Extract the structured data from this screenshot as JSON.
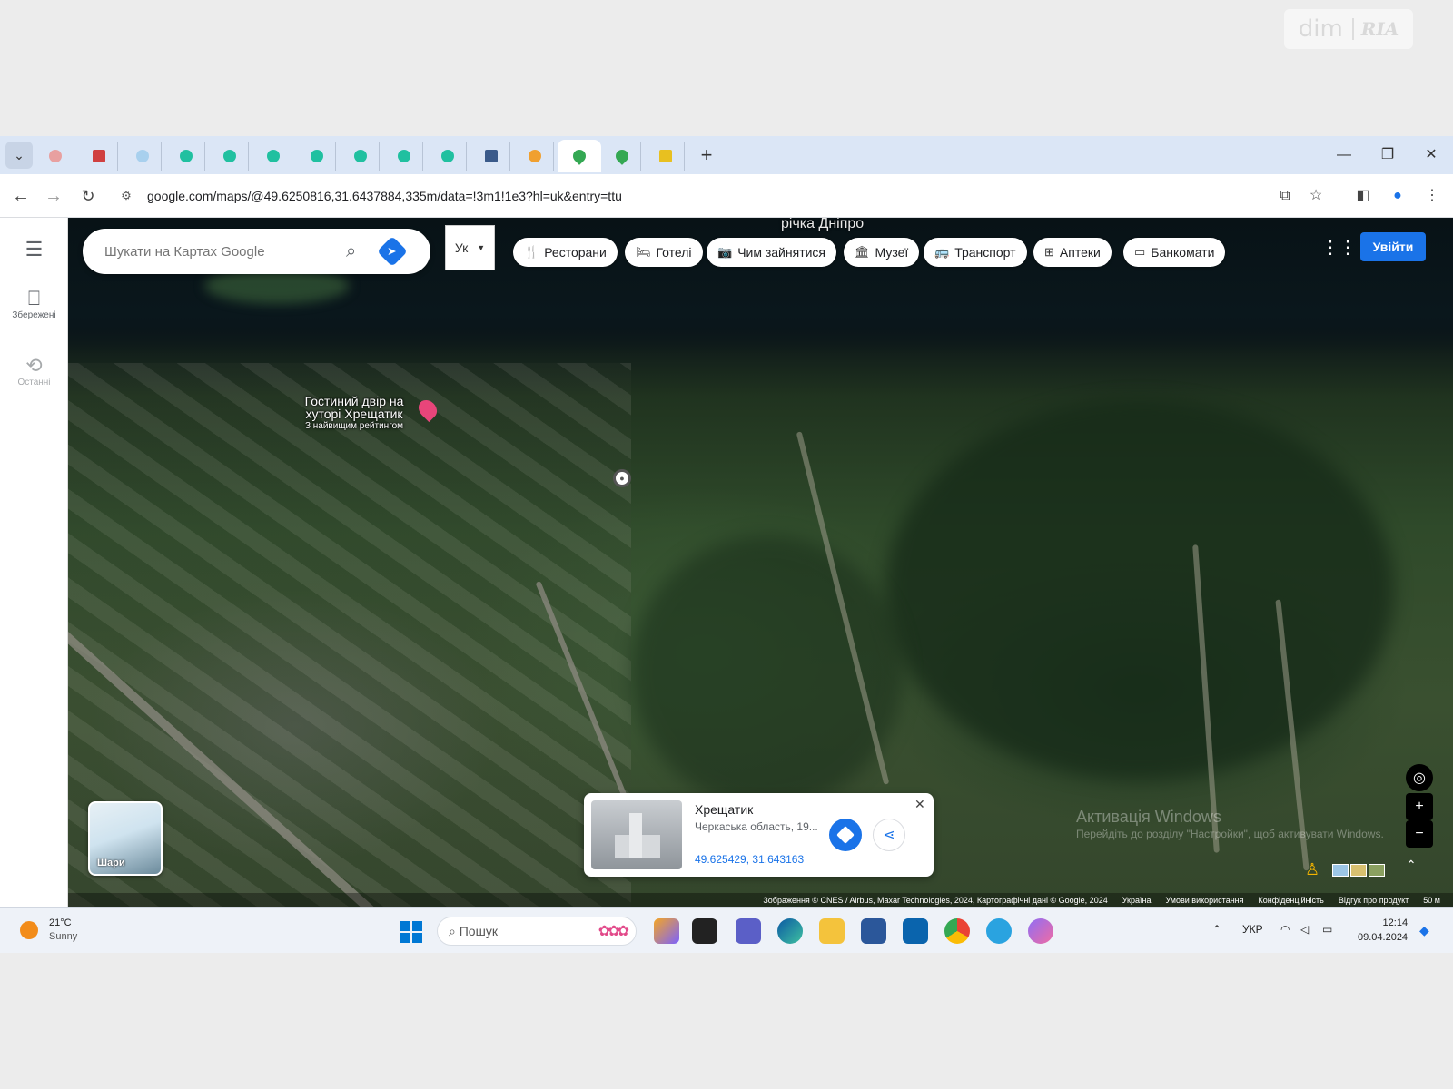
{
  "watermark": {
    "dim": "dim",
    "ria": "RIA"
  },
  "browser": {
    "tab_count": 15,
    "url": "google.com/maps/@49.6250816,31.6437884,335m/data=!3m1!1e3?hl=uk&entry=ttu",
    "new_tab": "+",
    "win_min": "—",
    "win_restore": "❐",
    "win_close": "✕"
  },
  "sidebar": {
    "menu_icon": "☰",
    "saved_label": "Збережені",
    "recent_label": "Останні"
  },
  "map": {
    "river_label": "річка Дніпро",
    "search_placeholder": "Шукати на Картах Google",
    "language": "Ук",
    "chips": [
      {
        "icon": "fork-knife-icon",
        "glyph": "🍴",
        "label": "Ресторани"
      },
      {
        "icon": "bed-icon",
        "glyph": "🛏",
        "label": "Готелі"
      },
      {
        "icon": "camera-icon",
        "glyph": "📷",
        "label": "Чим зайнятися"
      },
      {
        "icon": "museum-icon",
        "glyph": "🏛",
        "label": "Музеї"
      },
      {
        "icon": "transit-icon",
        "glyph": "🚌",
        "label": "Транспорт"
      },
      {
        "icon": "pharmacy-icon",
        "glyph": "⊞",
        "label": "Аптеки"
      },
      {
        "icon": "atm-icon",
        "glyph": "▭",
        "label": "Банкомати"
      }
    ],
    "signin": "Увійти",
    "poi": {
      "line1": "Гостиний двір на",
      "line2": "хуторі Хрещатик",
      "line3": "З найвищим рейтингом"
    },
    "layers_label": "Шари",
    "activate": {
      "title": "Активація Windows",
      "sub": "Перейдіть до розділу \"Настройки\", щоб активувати Windows."
    },
    "attribution": {
      "imagery": "Зображення © CNES / Airbus, Maxar Technologies, 2024, Картографічні дані © Google, 2024",
      "country": "Україна",
      "terms": "Умови використання",
      "privacy": "Конфіденційність",
      "feedback": "Відгук про продукт",
      "scale": "50 м"
    }
  },
  "infocard": {
    "title": "Хрещатик",
    "subtitle": "Черкаська область, 19...",
    "coords": "49.625429, 31.643163",
    "close": "✕"
  },
  "taskbar": {
    "temp": "21°C",
    "condition": "Sunny",
    "search_label": "Пошук",
    "lang": "УКР",
    "time": "12:14",
    "date": "09.04.2024"
  }
}
